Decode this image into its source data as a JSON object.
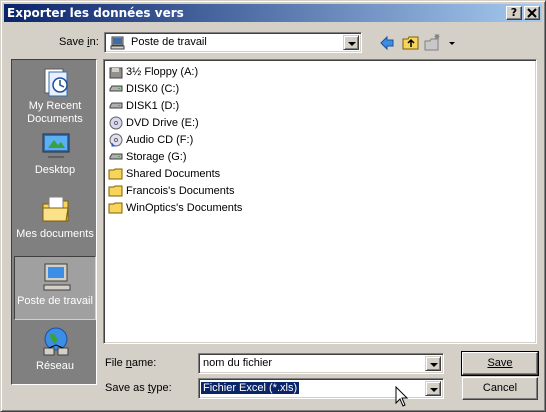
{
  "window": {
    "title": "Exporter les données vers",
    "help_btn": "?",
    "close_btn": "✕"
  },
  "save_in": {
    "label": "Save in:",
    "value": "Poste de travail"
  },
  "places": [
    {
      "label": "My Recent Documents",
      "icon": "recent-documents-icon"
    },
    {
      "label": "Desktop",
      "icon": "desktop-icon"
    },
    {
      "label": "Mes documents",
      "icon": "my-documents-icon"
    },
    {
      "label": "Poste de travail",
      "icon": "my-computer-icon",
      "active": true
    },
    {
      "label": "Réseau",
      "icon": "network-icon"
    }
  ],
  "files": [
    {
      "name": "3½ Floppy (A:)",
      "icon": "floppy-icon"
    },
    {
      "name": "DISK0 (C:)",
      "icon": "hard-drive-icon"
    },
    {
      "name": "DISK1 (D:)",
      "icon": "hard-drive-icon"
    },
    {
      "name": "DVD Drive (E:)",
      "icon": "dvd-drive-icon"
    },
    {
      "name": "Audio CD (F:)",
      "icon": "audio-cd-icon"
    },
    {
      "name": "Storage (G:)",
      "icon": "hard-drive-icon"
    },
    {
      "name": "Shared Documents",
      "icon": "folder-icon"
    },
    {
      "name": "Francois's Documents",
      "icon": "folder-icon"
    },
    {
      "name": "WinOptics's Documents",
      "icon": "folder-icon"
    }
  ],
  "file_name": {
    "label": "File name:",
    "value": "nom du fichier"
  },
  "save_as_type": {
    "label": "Save as type:",
    "value": "Fichier Excel (*.xls)"
  },
  "buttons": {
    "save": "Save",
    "cancel": "Cancel"
  }
}
